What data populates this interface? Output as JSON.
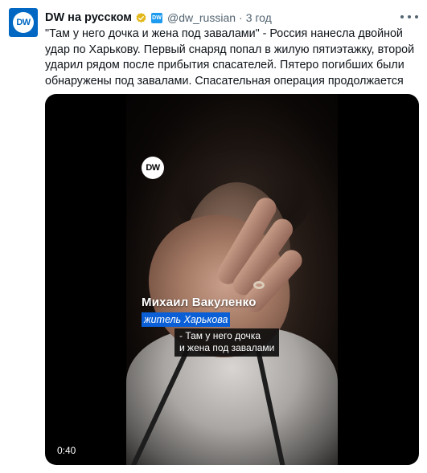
{
  "tweet": {
    "author": {
      "display_name": "DW на русском",
      "handle": "@dw_russian",
      "avatar_icon": "dw-logo",
      "avatar_text": "DW",
      "verified": true,
      "badge_icon": "organization-badge-icon"
    },
    "separator": "·",
    "time": "3 год",
    "text": "\"Там у него дочка и жена под завалами\" - Россия нанесла двойной удар по Харькову. Первый снаряд попал в жилую пятиэтажку, второй ударил рядом после прибытия спасателей. Пятеро погибших были обнаружены под завалами. Спасательная операция продолжается",
    "media": {
      "type": "video",
      "watermark": "DW",
      "caption_name": "Михаил Вакуленко",
      "caption_role": "житель Харькова",
      "quote_line1": "- Там у него дочка",
      "quote_line2": "и жена под завалами",
      "duration": "0:40"
    }
  },
  "colors": {
    "brand_blue": "#0068c2",
    "verified_gold": "#e2b719",
    "caption_blue": "#0a5fd6",
    "secondary_text": "#536471"
  }
}
